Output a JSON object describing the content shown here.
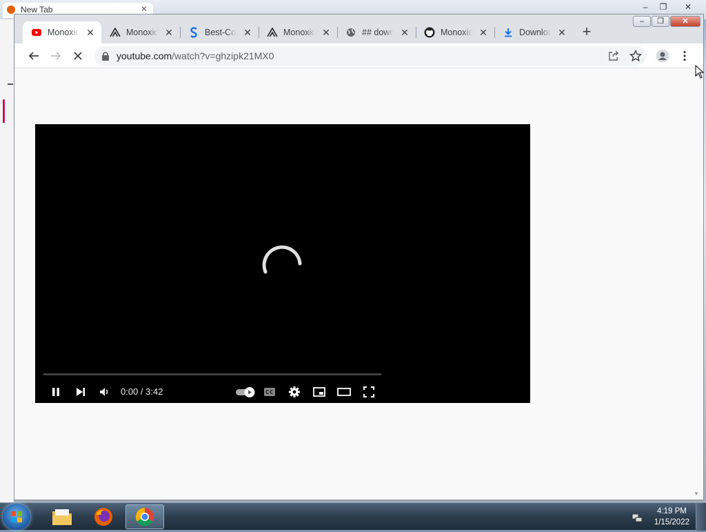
{
  "background_window": {
    "tab_label": "New Tab",
    "controls": [
      "–",
      "❐",
      "✕"
    ]
  },
  "browser": {
    "tabs": [
      {
        "title": "Monoxide",
        "favicon": "youtube-icon",
        "active": true
      },
      {
        "title": "Monoxide",
        "favicon": "monoxide-logo-icon",
        "active": false
      },
      {
        "title": "Best-Codec",
        "favicon": "dollar-s-icon",
        "active": false
      },
      {
        "title": "Monoxide",
        "favicon": "monoxide-logo-icon",
        "active": false
      },
      {
        "title": "## download",
        "favicon": "globe-icon",
        "active": false
      },
      {
        "title": "Monoxide",
        "favicon": "github-icon",
        "active": false
      },
      {
        "title": "Download",
        "favicon": "download-icon",
        "active": false
      }
    ],
    "new_tab_label": "+",
    "tab_close": "✕",
    "address": {
      "host": "youtube.com",
      "path": "/watch?v=ghzipk21MX0"
    },
    "window_controls": {
      "minimize": "–",
      "maximize": "❐",
      "close": "✕"
    }
  },
  "player": {
    "state": "loading",
    "time_current": "0:00",
    "time_separator": " / ",
    "time_total": "3:42",
    "progress_fraction": 0,
    "autoplay": "on"
  },
  "taskbar": {
    "clock_time": "4:19 PM",
    "clock_date": "1/15/2022",
    "items": [
      "file-explorer-icon",
      "firefox-icon",
      "chrome-icon"
    ],
    "active_item": "chrome-icon"
  },
  "colors": {
    "youtube_red": "#ff0000",
    "chrome_frame": "#dee1e6",
    "omnibox": "#f1f3f4"
  }
}
